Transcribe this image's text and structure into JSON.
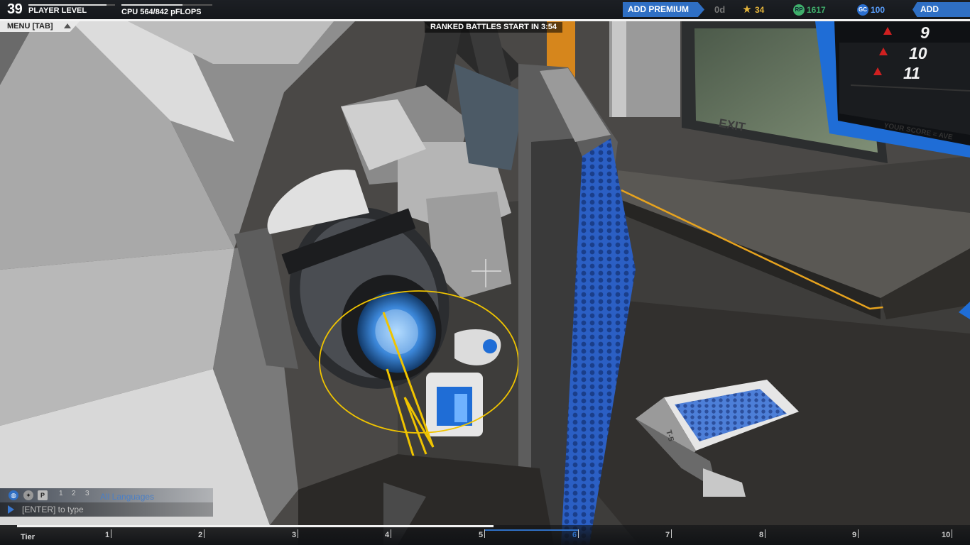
{
  "player": {
    "level": "39",
    "level_label": "PLAYER LEVEL",
    "level_progress": 0.9,
    "cpu_label": "CPU 564/842 pFLOPS",
    "cpu_fraction": 0.67
  },
  "store": {
    "add_premium": "ADD PREMIUM",
    "premium_days": "0d",
    "stars": "34",
    "robit_points": "1617",
    "galaxy_coins": "100",
    "rp_icon_text": "RP",
    "gc_icon_text": "GC",
    "add_funds": "ADD FUNDS"
  },
  "menu": {
    "label": "MENU [TAB]"
  },
  "banner": {
    "ranked": "RANKED BATTLES START IN 3:54"
  },
  "scoreboard": {
    "values": [
      "9",
      "10",
      "11"
    ]
  },
  "scene_text": {
    "exit": "EXIT",
    "your_score": "YOUR SCORE = AVE",
    "block_label": "T-5"
  },
  "chat": {
    "party_icon_text": "P",
    "channels": [
      "1",
      "2",
      "3"
    ],
    "language": "All Languages",
    "placeholder": "[ENTER] to type"
  },
  "tiers": {
    "label": "Tier",
    "ticks": [
      "1",
      "2",
      "3",
      "4",
      "5",
      "6",
      "7",
      "8",
      "9",
      "10"
    ],
    "progress_tier": 5.1,
    "current_tier": "6"
  },
  "colors": {
    "accent_blue": "#2f6fc4",
    "gold": "#e5b53b",
    "rp_green": "#3fae6b",
    "score_red": "#d02020"
  },
  "icons": {
    "stars": "star-icon",
    "rp": "robit-points-icon",
    "gc": "galaxy-coins-icon",
    "chat_public": "globe-icon",
    "chat_team": "team-icon",
    "chat_party": "party-icon",
    "score_marker": "triangle-icon",
    "menu": "caret-up-icon",
    "chat_send": "play-arrow-icon"
  }
}
